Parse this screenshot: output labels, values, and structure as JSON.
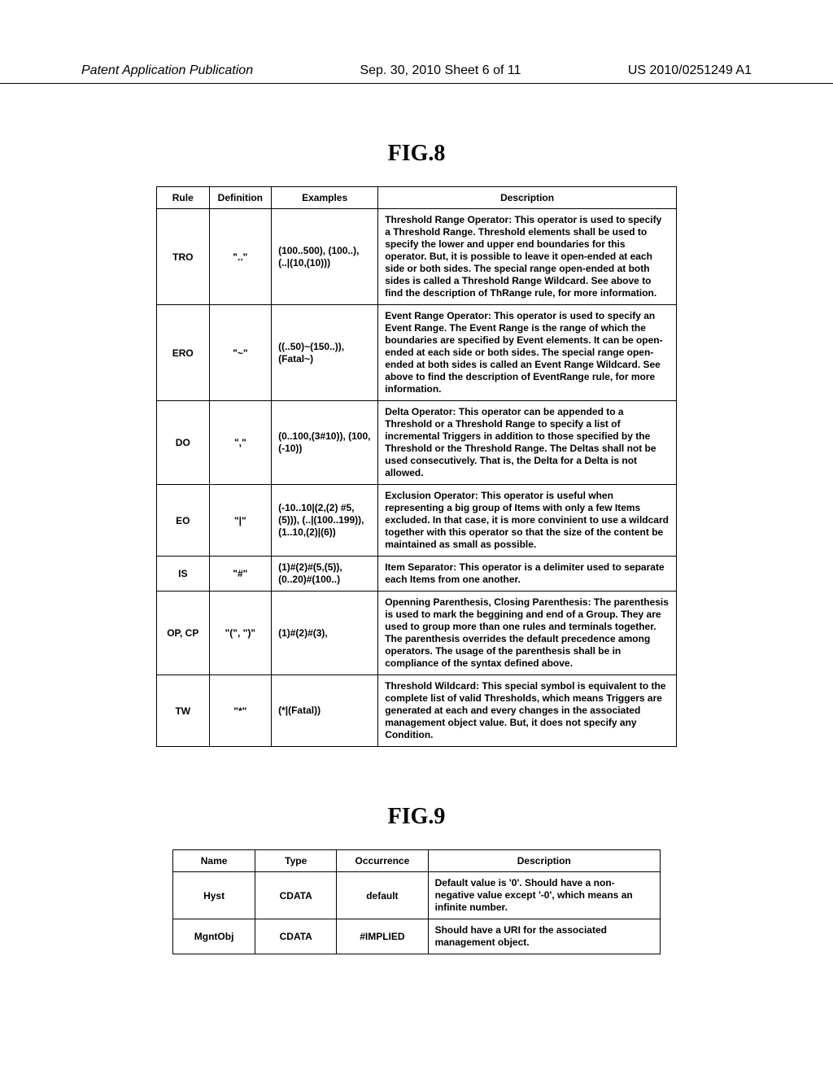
{
  "header": {
    "left": "Patent Application Publication",
    "center": "Sep. 30, 2010  Sheet 6 of 11",
    "right": "US 2010/0251249 A1"
  },
  "fig8": {
    "title": "FIG.8",
    "columns": [
      "Rule",
      "Definition",
      "Examples",
      "Description"
    ],
    "rows": [
      {
        "rule": "TRO",
        "definition": "\"..\"",
        "examples": "(100..500),\n(100..),\n(..|(10,(10)))",
        "description": "Threshold Range Operator: This operator is used to specify a Threshold Range. Threshold elements shall be used to specify the lower and upper end boundaries for this operator. But, it is possible to leave it open-ended at each side or both sides. The special range open-ended at both sides is called a Threshold Range Wildcard. See above to find the description of ThRange rule, for more information."
      },
      {
        "rule": "ERO",
        "definition": "\"~\"",
        "examples": "((..50)~(150..)),\n(Fatal~)",
        "description": "Event Range Operator: This operator is used to specify an Event Range. The Event Range is the range of which the boundaries are specified by Event elements. It can be open-ended at each side or both sides. The special range open-ended at both sides is called an Event Range Wildcard. See above to find the description of EventRange rule, for more information."
      },
      {
        "rule": "DO",
        "definition": "\",\"",
        "examples": "(0..100,(3#10)),\n(100,(-10))",
        "description": "Delta Operator: This operator can be appended to a Threshold or a Threshold Range to specify a list of incremental Triggers in addition to those specified by the Threshold or the Threshold Range. The Deltas shall not be used consecutively. That is, the Delta for a Delta is not allowed."
      },
      {
        "rule": "EO",
        "definition": "\"|\"",
        "examples": "(-10..10|(2,(2)\n#5,(5))),\n(..|(100..199)),\n(1..10,(2)|(6))",
        "description": "Exclusion Operator: This operator is useful when representing a big group of Items with only a few Items excluded. In that case, it is more convinient to use a wildcard together with this operator so that the size of the content be maintained as small as possible."
      },
      {
        "rule": "IS",
        "definition": "\"#\"",
        "examples": "(1)#(2)#(5,(5)),\n(0..20)#(100..)",
        "description": "Item Separator: This operator is a delimiter used to separate each Items from one another."
      },
      {
        "rule": "OP, CP",
        "definition": "\"(\", \")\"",
        "examples": "(1)#(2)#(3),",
        "description": "Openning Parenthesis, Closing Parenthesis: The parenthesis is used to mark the beggining and end of a Group. They are used to group more than one rules and terminals together. The parenthesis overrides the default precedence among operators. The usage of the parenthesis shall be in compliance of the syntax defined above."
      },
      {
        "rule": "TW",
        "definition": "\"*\"",
        "examples": "(*|(Fatal))",
        "description": "Threshold Wildcard: This special symbol is equivalent to the complete list of valid Thresholds, which means Triggers are generated at each and every changes in the associated management object value. But, it does not specify any Condition."
      }
    ]
  },
  "fig9": {
    "title": "FIG.9",
    "columns": [
      "Name",
      "Type",
      "Occurrence",
      "Description"
    ],
    "rows": [
      {
        "name": "Hyst",
        "type": "CDATA",
        "occurrence": "default",
        "description": "Default value is '0'.\nShould have a non-negative value except '-0', which means an infinite number."
      },
      {
        "name": "MgntObj",
        "type": "CDATA",
        "occurrence": "#IMPLIED",
        "description": "Should have a URI for the associated management object."
      }
    ]
  }
}
